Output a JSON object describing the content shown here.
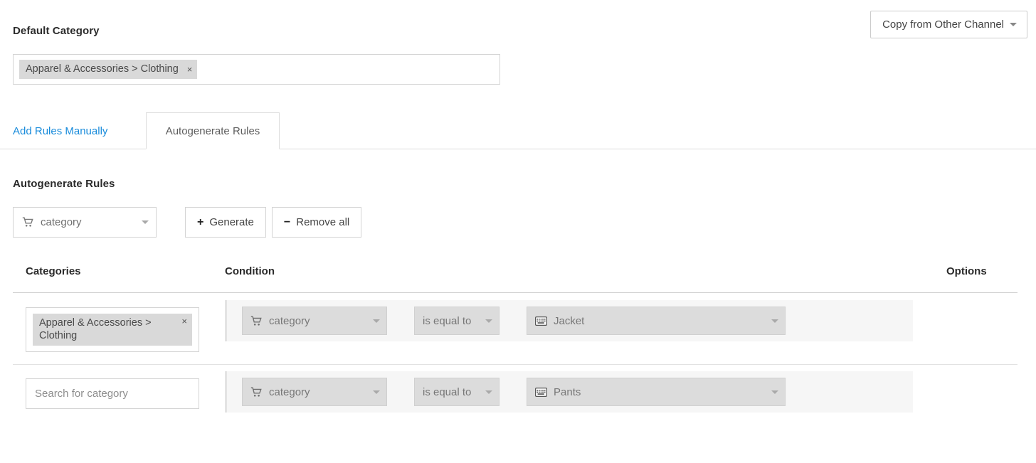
{
  "header": {
    "default_category_title": "Default Category",
    "copy_button_label": "Copy from Other Channel",
    "default_category_token": "Apparel & Accessories > Clothing",
    "token_remove_label": "×"
  },
  "tabs": [
    {
      "label": "Add Rules Manually",
      "active": false
    },
    {
      "label": "Autogenerate Rules",
      "active": true
    }
  ],
  "autogenerate": {
    "title": "Autogenerate Rules",
    "attribute_select": {
      "value": "category",
      "icon": "cart-icon"
    },
    "generate_button": {
      "glyph": "+",
      "label": "Generate"
    },
    "remove_all_button": {
      "glyph": "−",
      "label": "Remove all"
    }
  },
  "table": {
    "columns": {
      "categories": "Categories",
      "condition": "Condition",
      "options": "Options"
    },
    "rows": [
      {
        "category_token": "Apparel & Accessories > Clothing",
        "category_token_remove": "×",
        "field": {
          "value": "category",
          "icon": "cart-icon"
        },
        "operator": {
          "value": "is equal to"
        },
        "value": {
          "value": "Jacket",
          "icon": "keyboard-icon"
        }
      },
      {
        "category_placeholder": "Search for category",
        "category_value": "",
        "field": {
          "value": "category",
          "icon": "cart-icon"
        },
        "operator": {
          "value": "is equal to"
        },
        "value": {
          "value": "Pants",
          "icon": "keyboard-icon"
        }
      }
    ]
  },
  "colors": {
    "link": "#1a8cdb",
    "token_bg": "#d9d9d9",
    "row_bg": "#f6f6f6",
    "control_bg": "#dcdcdc",
    "border": "#d4d4d4"
  }
}
